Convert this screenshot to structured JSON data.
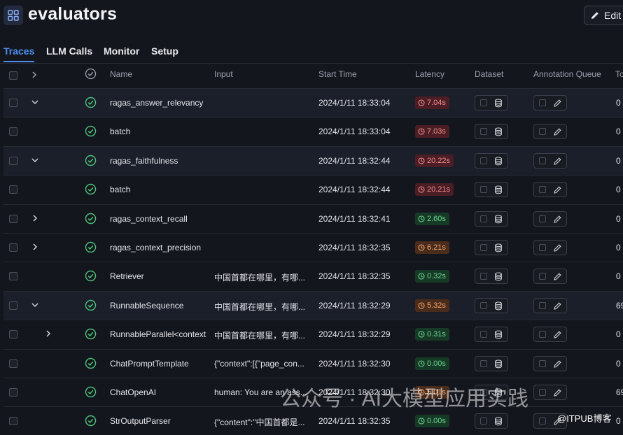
{
  "app": {
    "title": "evaluators",
    "edit_label": "Edit"
  },
  "tabs": [
    {
      "label": "Traces",
      "active": true
    },
    {
      "label": "LLM Calls"
    },
    {
      "label": "Monitor"
    },
    {
      "label": "Setup"
    }
  ],
  "columns": {
    "name": "Name",
    "input": "Input",
    "start_time": "Start Time",
    "latency": "Latency",
    "dataset": "Dataset",
    "annotation_queue": "Annotation Queue",
    "tokens": "To"
  },
  "colors": {
    "accent": "#4b8ff0",
    "latency_red": "#f28b8b",
    "latency_orange": "#f2a36a",
    "latency_green": "#69d38f"
  },
  "rows": [
    {
      "expand": "down",
      "indent": 0,
      "name": "ragas_answer_relevancy",
      "input": "",
      "start": "2024/1/11 18:33:04",
      "latency": "7.04s",
      "lat_color": "red",
      "tokens": "0"
    },
    {
      "expand": "none",
      "indent": 0,
      "name": "batch",
      "input": "",
      "start": "2024/1/11 18:33:04",
      "latency": "7.03s",
      "lat_color": "red",
      "tokens": "0"
    },
    {
      "expand": "down",
      "indent": 0,
      "name": "ragas_faithfulness",
      "input": "",
      "start": "2024/1/11 18:32:44",
      "latency": "20.22s",
      "lat_color": "red",
      "tokens": "0"
    },
    {
      "expand": "none",
      "indent": 0,
      "name": "batch",
      "input": "",
      "start": "2024/1/11 18:32:44",
      "latency": "20.21s",
      "lat_color": "red",
      "tokens": "0"
    },
    {
      "expand": "right",
      "indent": 0,
      "name": "ragas_context_recall",
      "input": "",
      "start": "2024/1/11 18:32:41",
      "latency": "2.60s",
      "lat_color": "green",
      "tokens": "0"
    },
    {
      "expand": "right",
      "indent": 0,
      "name": "ragas_context_precision",
      "input": "",
      "start": "2024/1/11 18:32:35",
      "latency": "6.21s",
      "lat_color": "orange",
      "tokens": "0"
    },
    {
      "expand": "none",
      "indent": 0,
      "name": "Retriever",
      "input": "中国首都在哪里，有哪...",
      "start": "2024/1/11 18:32:35",
      "latency": "0.32s",
      "lat_color": "green",
      "tokens": "0"
    },
    {
      "expand": "down",
      "indent": 0,
      "name": "RunnableSequence",
      "input": "中国首都在哪里，有哪...",
      "start": "2024/1/11 18:32:29",
      "latency": "5.32s",
      "lat_color": "orange",
      "tokens": "69"
    },
    {
      "expand": "right",
      "indent": 1,
      "name": "RunnableParallel<context>",
      "input": "中国首都在哪里，有哪...",
      "start": "2024/1/11 18:32:29",
      "latency": "0.31s",
      "lat_color": "green",
      "tokens": "0"
    },
    {
      "expand": "none",
      "indent": 0,
      "name": "ChatPromptTemplate",
      "input": "{\"context\":[{\"page_con...",
      "start": "2024/1/11 18:32:30",
      "latency": "0.00s",
      "lat_color": "green",
      "tokens": "0"
    },
    {
      "expand": "none",
      "indent": 0,
      "name": "ChatOpenAI",
      "input": "human: You are an ass...",
      "start": "2024/1/11 18:32:30",
      "latency": "5.01s",
      "lat_color": "orange",
      "tokens": "69"
    },
    {
      "expand": "none",
      "indent": 0,
      "name": "StrOutputParser",
      "input": "{\"content\":\"中国首都是...",
      "start": "2024/1/11 18:32:35",
      "latency": "0.00s",
      "lat_color": "green",
      "tokens": "0"
    }
  ],
  "watermark": {
    "main": "公众号 · AI大模型应用实践",
    "corner": "@ITPUB博客"
  }
}
